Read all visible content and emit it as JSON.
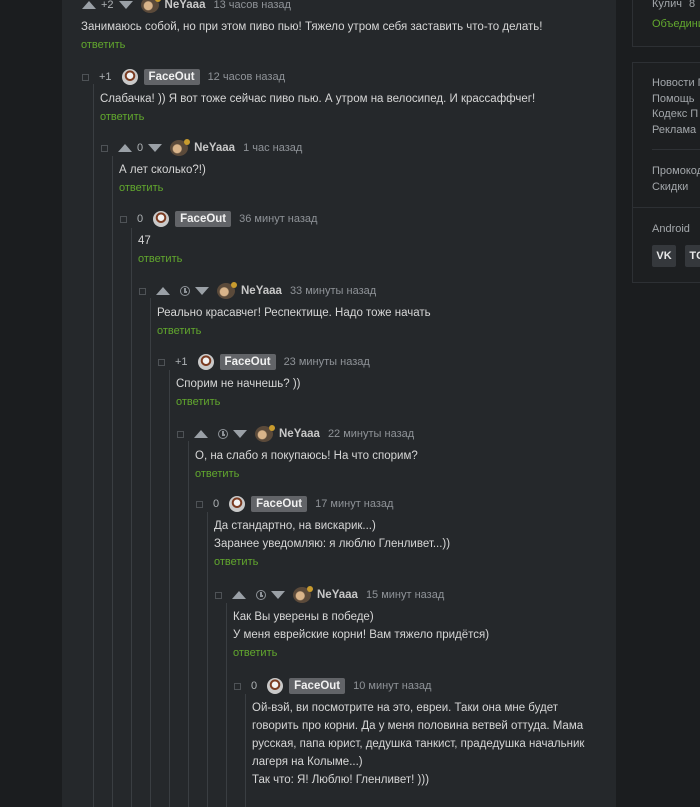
{
  "comments": [
    {
      "rating": "+2",
      "author": "NeYaaa",
      "time": "13 часов назад",
      "text": [
        "Занимаюсь собой, но при этом пиво пью! Тяжело утром себя заставить что-то делать!"
      ],
      "reply": "ответить"
    },
    {
      "rating": "+1",
      "author": "FaceOut",
      "time": "12 часов назад",
      "text": [
        "Слабачка! )) Я вот тоже сейчас пиво пью. А утром на велосипед. И крассаффчег!"
      ],
      "reply": "ответить"
    },
    {
      "rating": "0",
      "author": "NeYaaa",
      "time": "1 час назад",
      "text": [
        "А лет сколько?!)"
      ],
      "reply": "ответить"
    },
    {
      "rating": "0",
      "author": "FaceOut",
      "time": "36 минут назад",
      "text": [
        "47"
      ],
      "reply": "ответить"
    },
    {
      "rating": "",
      "author": "NeYaaa",
      "time": "33 минуты назад",
      "text": [
        "Реально красавчег! Респектище. Надо тоже начать"
      ],
      "reply": "ответить"
    },
    {
      "rating": "+1",
      "author": "FaceOut",
      "time": "23 минуты назад",
      "text": [
        "Спорим не начнешь? ))"
      ],
      "reply": "ответить"
    },
    {
      "rating": "",
      "author": "NeYaaa",
      "time": "22 минуты назад",
      "text": [
        "О, на слабо я покупаюсь! На что спорим?"
      ],
      "reply": "ответить"
    },
    {
      "rating": "0",
      "author": "FaceOut",
      "time": "17 минут назад",
      "text": [
        "Да стандартно, на вискарик...)",
        "Заранее уведомляю: я люблю Гленливет...))"
      ],
      "reply": "ответить"
    },
    {
      "rating": "",
      "author": "NeYaaa",
      "time": "15 минут назад",
      "text": [
        "Как Вы уверены в победе)",
        "У меня еврейские корни! Вам тяжело придётся)"
      ],
      "reply": "ответить"
    },
    {
      "rating": "0",
      "author": "FaceOut",
      "time": "10 минут назад",
      "text": [
        "Ой-вэй, ви посмотрите на это, евреи. Таки она мне будет",
        "говорить про корни. Да у меня половина ветвей оттуда. Мама",
        "русская, папа юрист, дедушка танкист, прадедушка начальник",
        "лагеря на Колыме...)",
        "Так что: Я! Люблю! Гленливет! )))"
      ],
      "reply": ""
    }
  ],
  "sidebar": {
    "top": {
      "label": "Кулич",
      "count": "8",
      "link": "Объедини"
    },
    "links1": [
      "Новости П",
      "Помощь",
      "Кодекс П",
      "Реклама"
    ],
    "links2": [
      "Промокод",
      "Скидки"
    ],
    "apps": {
      "label": "Android",
      "social": [
        "VK",
        "TG"
      ]
    }
  }
}
